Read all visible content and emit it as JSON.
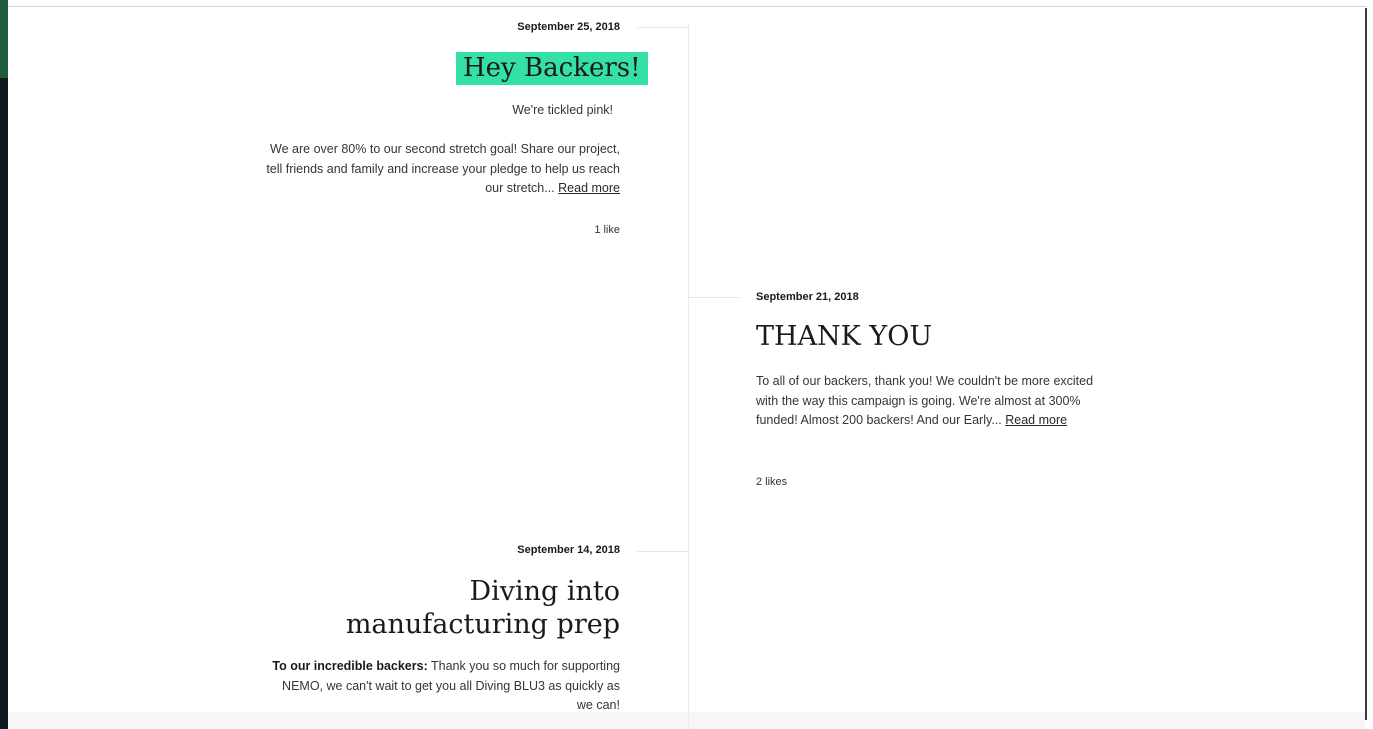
{
  "posts": [
    {
      "date": "September 25, 2018",
      "title": "Hey Backers!",
      "subtitle": "We're tickled pink!",
      "excerpt": "We are over 80% to our second stretch goal! Share our project, tell friends and family and increase your pledge to help us reach our stretch...",
      "read_more": "Read more",
      "likes": "1 like",
      "highlight_color": "#34e0a8"
    },
    {
      "date": "September 21, 2018",
      "title": "THANK YOU",
      "excerpt": "To all of our backers, thank you! We couldn't be more excited with the way this campaign is going. We're almost at 300% funded! Almost 200 backers! And our Early...",
      "read_more": "Read more",
      "likes": "2 likes"
    },
    {
      "date": "September 14, 2018",
      "title": "Diving into manufacturing prep",
      "excerpt_lead": "To our incredible backers:",
      "excerpt": "Thank you so much for supporting NEMO, we can't wait to get you all Diving BLU3 as quickly as we can!"
    }
  ]
}
